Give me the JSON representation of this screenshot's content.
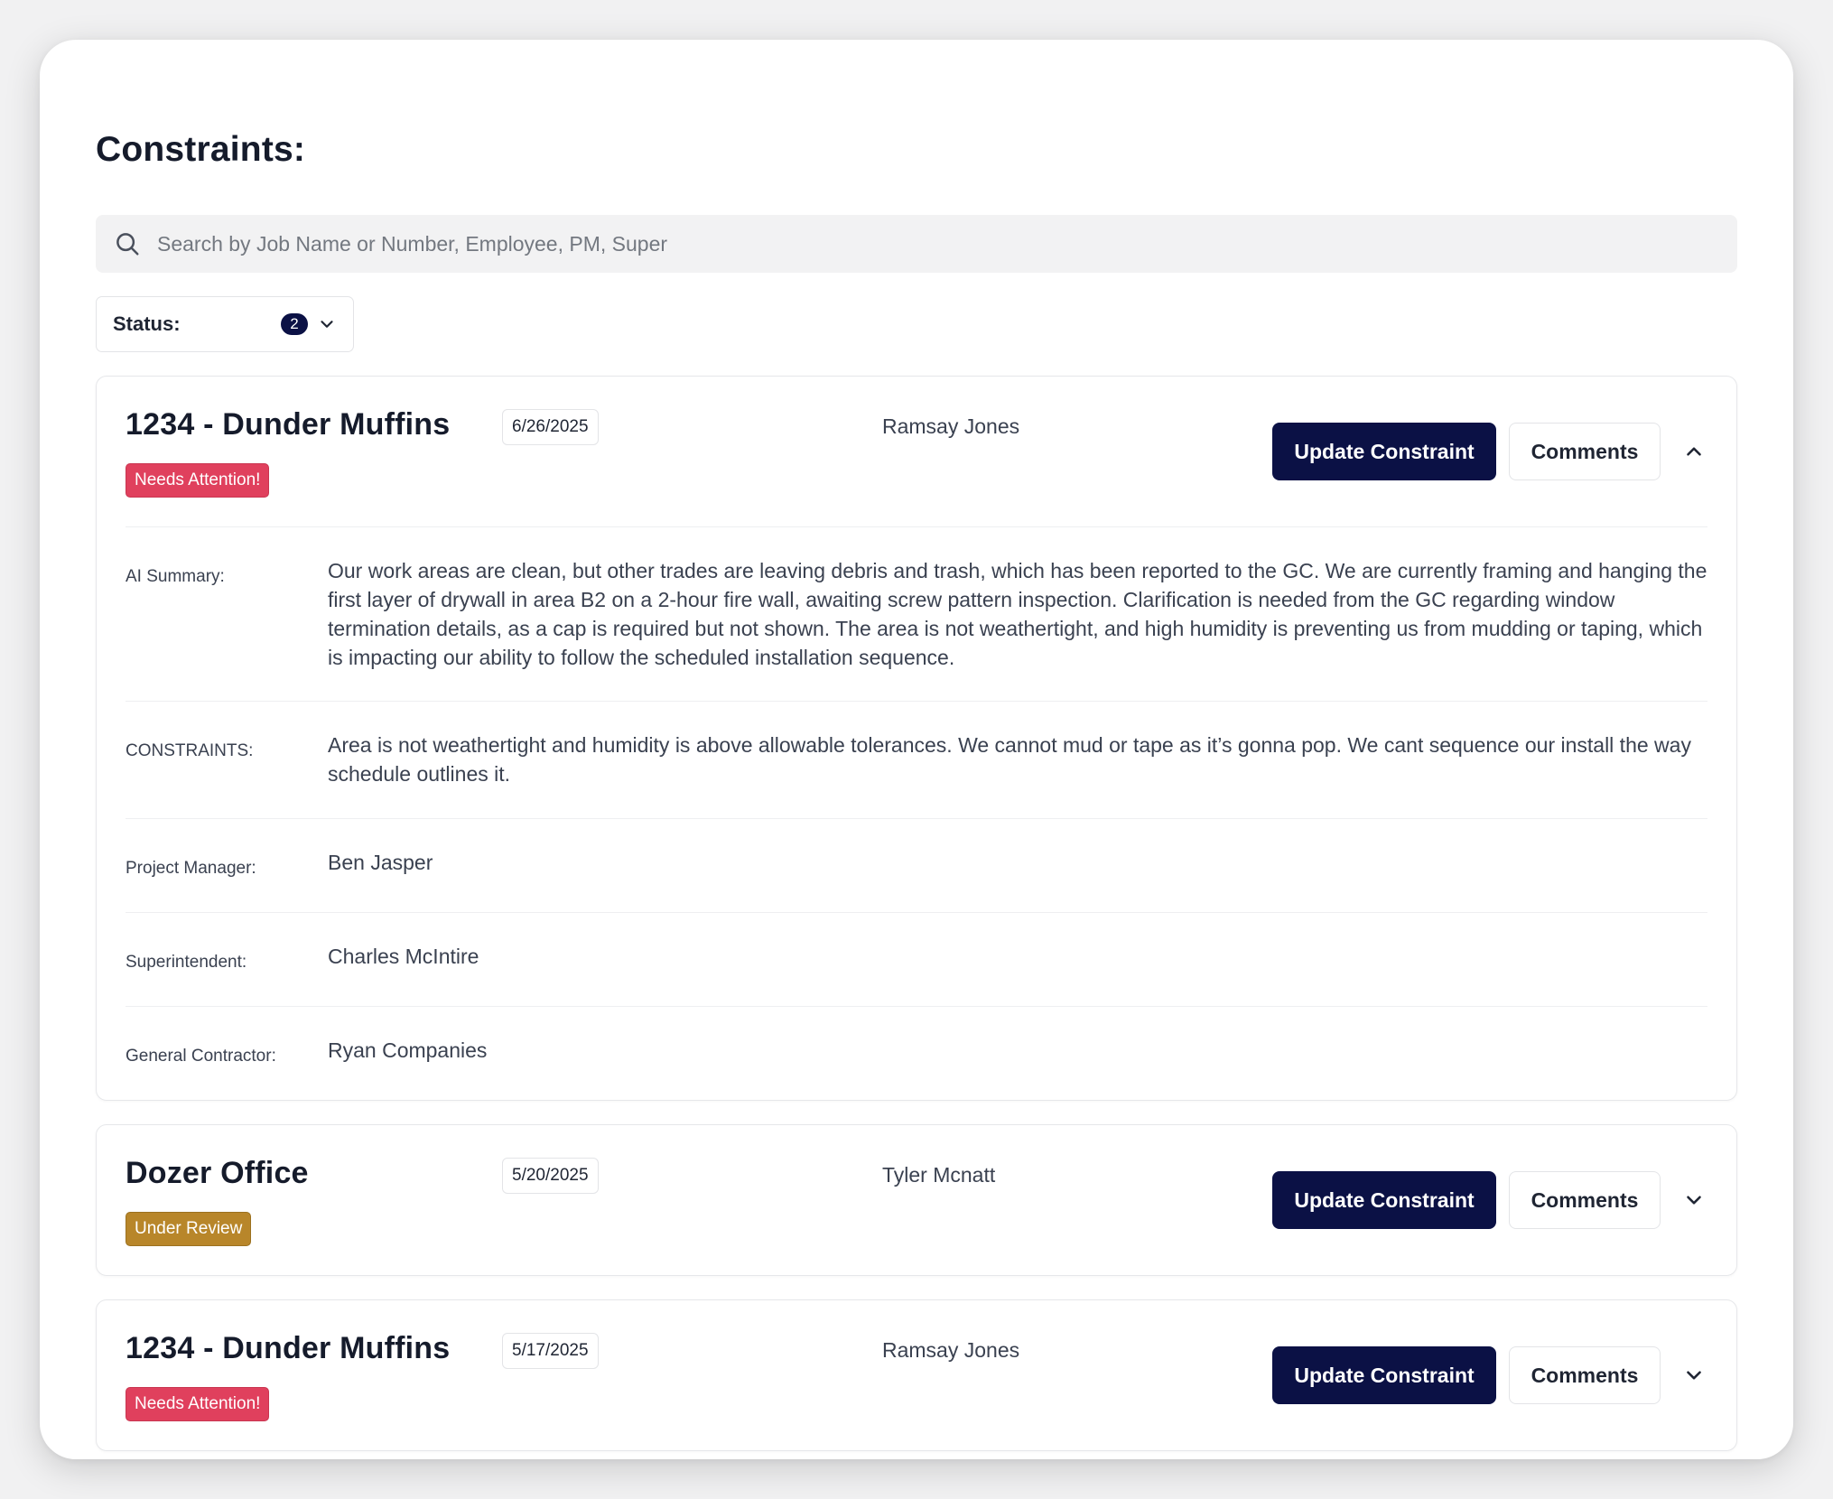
{
  "page": {
    "title": "Constraints:"
  },
  "search": {
    "placeholder": "Search by Job Name or Number, Employee, PM, Super"
  },
  "filter": {
    "label": "Status:",
    "count": "2"
  },
  "actions": {
    "update_label": "Update Constraint",
    "comments_label": "Comments"
  },
  "colors": {
    "primary": "#0b1145",
    "needs_attention": "#e0405d",
    "under_review": "#b8862a"
  },
  "cards": [
    {
      "title": "1234 - Dunder Muffins",
      "date": "6/26/2025",
      "person": "Ramsay Jones",
      "status": "Needs Attention!",
      "expanded": true,
      "details": {
        "ai_summary_label": "AI Summary:",
        "ai_summary": "Our work areas are clean, but other trades are leaving debris and trash, which has been reported to the GC. We are currently framing and hanging the first layer of drywall in area B2 on a 2-hour fire wall, awaiting screw pattern inspection. Clarification is needed from the GC regarding window termination details, as a cap is required but not shown. The area is not weathertight, and high humidity is preventing us from mudding or taping, which is impacting our ability to follow the scheduled installation sequence.",
        "constraints_label": "CONSTRAINTS:",
        "constraints": "Area is not weathertight and humidity is above allowable tolerances. We cannot mud or tape as it’s gonna pop. We cant sequence our install the way schedule outlines it.",
        "pm_label": "Project Manager:",
        "pm": "Ben Jasper",
        "super_label": "Superintendent:",
        "super": "Charles McIntire",
        "gc_label": "General Contractor:",
        "gc": "Ryan Companies"
      }
    },
    {
      "title": "Dozer Office",
      "date": "5/20/2025",
      "person": "Tyler Mcnatt",
      "status": "Under Review",
      "expanded": false
    },
    {
      "title": "1234 - Dunder Muffins",
      "date": "5/17/2025",
      "person": "Ramsay Jones",
      "status": "Needs Attention!",
      "expanded": false
    }
  ]
}
